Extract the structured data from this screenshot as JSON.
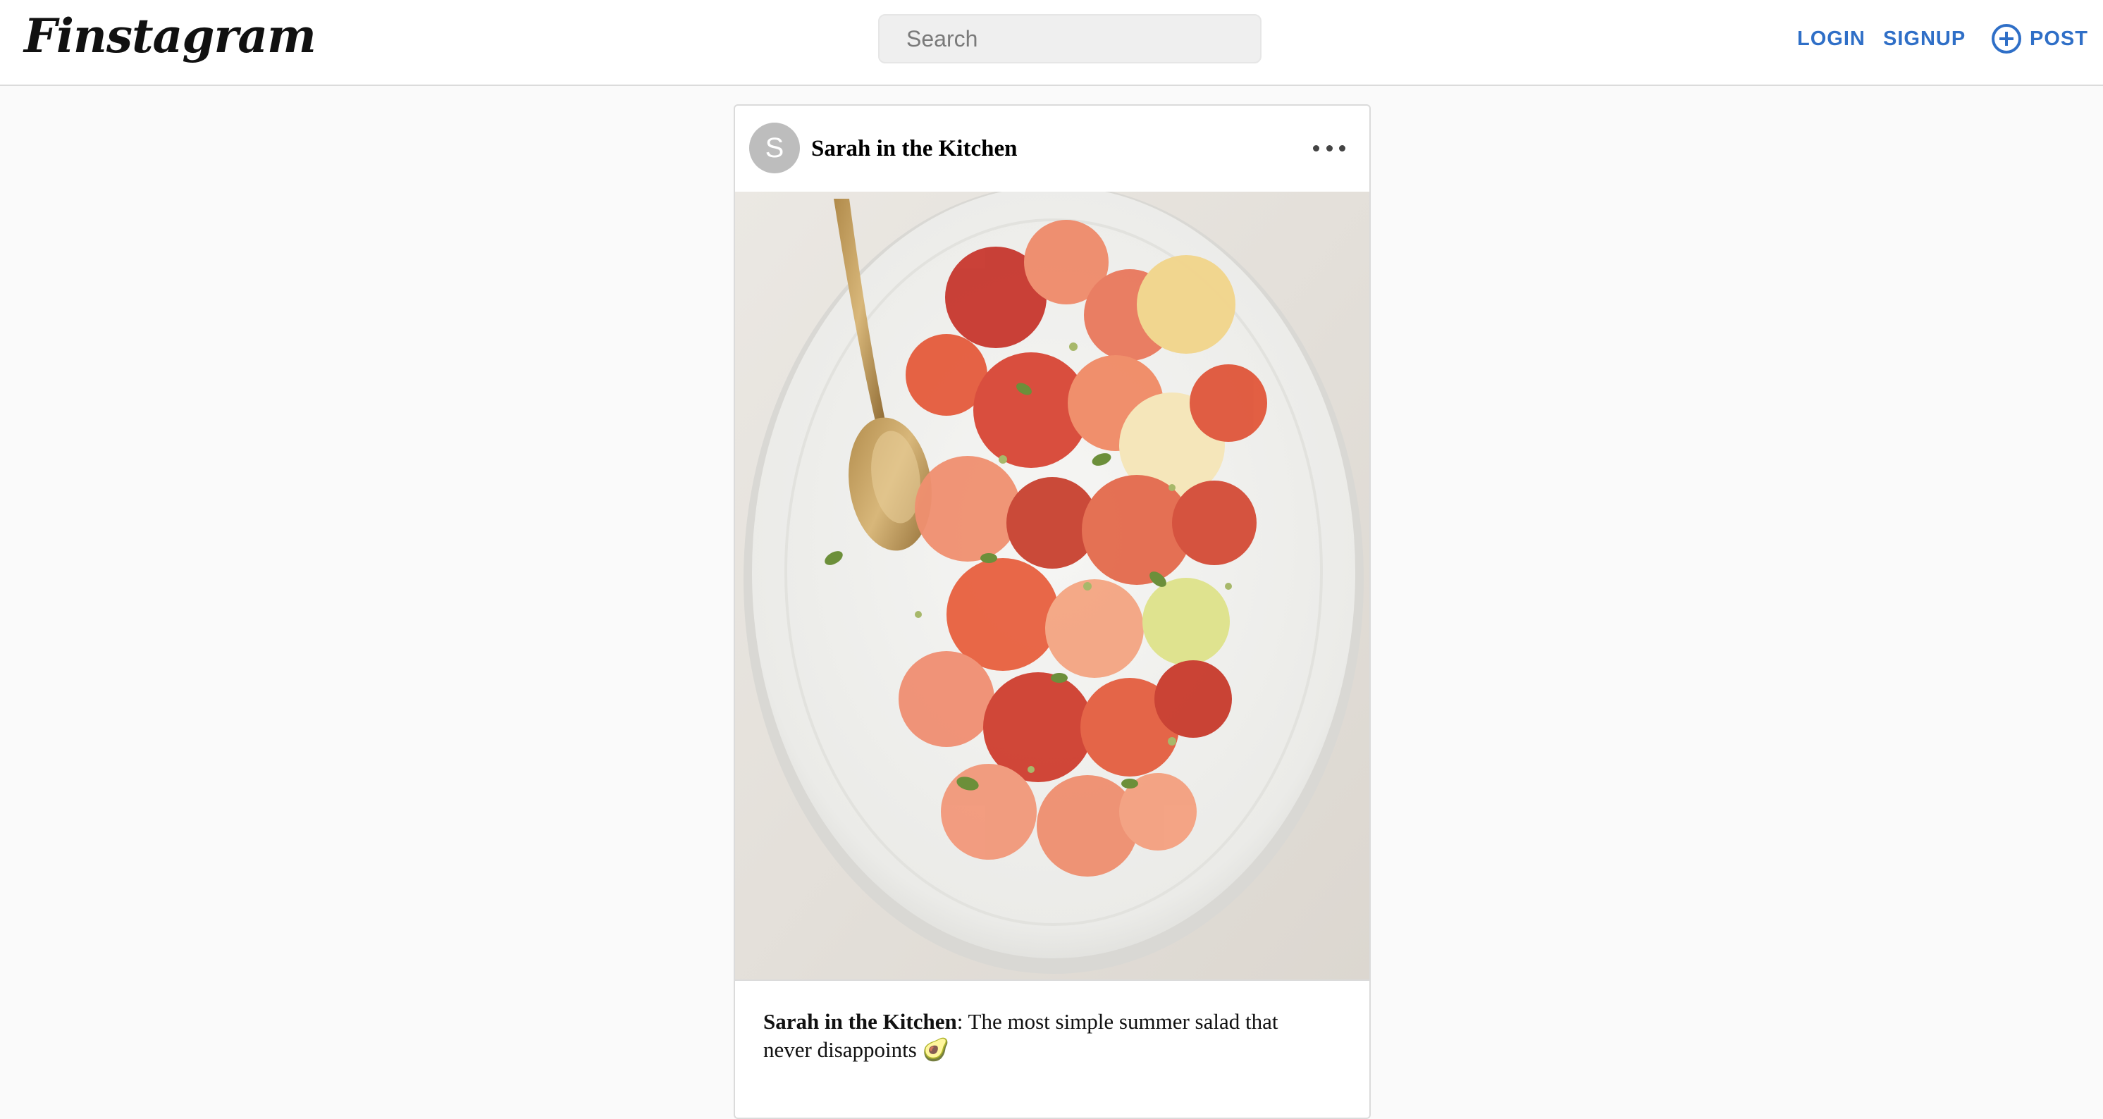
{
  "header": {
    "logo": "Finstagram",
    "search_placeholder": "Search",
    "login_label": "LOGIN",
    "signup_label": "SIGNUP",
    "post_label": "POST",
    "post_icon": "add-circle-icon",
    "accent_color": "#2f6fc7"
  },
  "post": {
    "avatar_letter": "S",
    "username": "Sarah in the Kitchen",
    "more_icon": "more-horizontal-icon",
    "image_alt": "citrus salad on oval white platter with gold spoon",
    "caption_user": "Sarah in the Kitchen",
    "caption_text": ": The most simple summer salad that never disappoints 🥑"
  }
}
